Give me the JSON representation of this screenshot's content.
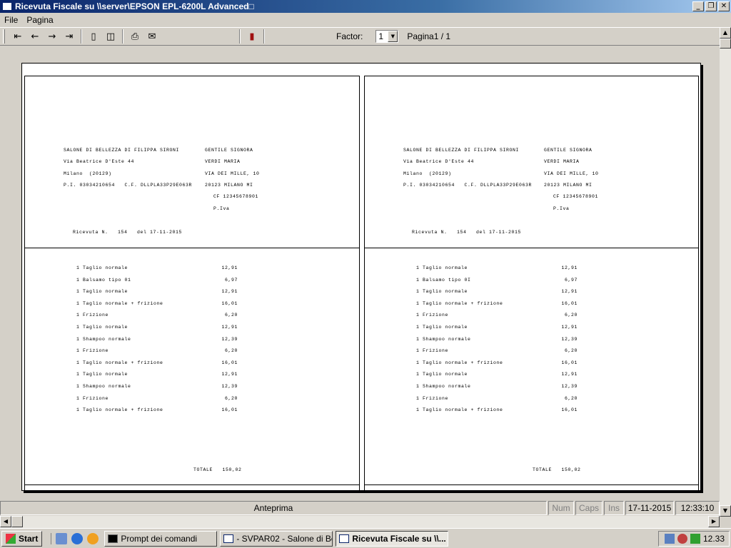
{
  "window": {
    "title": "Ricevuta Fiscale su \\\\server\\EPSON EPL-6200L Advanced□"
  },
  "menu": [
    "File",
    "Pagina"
  ],
  "toolbar": {
    "factor_label": "Factor:",
    "factor_value": "1",
    "page_label": "Pagina1 / 1"
  },
  "receipt": {
    "shop_name": "SALONE DI BELLEZZA DI FILIPPA SIRONI",
    "shop_address": "Via Beatrice D'Este 44",
    "shop_city": "Milano  (20129)",
    "shop_ids": "P.I. 03034210654   C.F. DLLPLA33P29E063R",
    "customer_greeting": "GENTILE SIGNORA",
    "customer_name": "VERDI MARIA",
    "customer_address": "VIA DEI MILLE, 10",
    "customer_city": "20123 MILANO MI",
    "customer_cf": "CF 12345678901",
    "customer_piva": "P.Iva",
    "receipt_number_line": "Ricevuta N.   154   del 17-11-2015",
    "total_line": "TOTALE   150,02"
  },
  "items_left": [
    {
      "desc": "1 Taglio normale",
      "price": "12,91"
    },
    {
      "desc": "1 Balsamo tipo 01",
      "price": "6,97"
    },
    {
      "desc": "1 Taglio normale",
      "price": "12,91"
    },
    {
      "desc": "1 Taglio normale + frizione",
      "price": "16,01"
    },
    {
      "desc": "1 Frizione",
      "price": "6,20"
    },
    {
      "desc": "1 Taglio normale",
      "price": "12,91"
    },
    {
      "desc": "1 Shampoo normale",
      "price": "12,39"
    },
    {
      "desc": "1 Frizione",
      "price": "6,20"
    },
    {
      "desc": "1 Taglio normale + frizione",
      "price": "16,01"
    },
    {
      "desc": "1 Taglio normale",
      "price": "12,91"
    },
    {
      "desc": "1 Shampoo normale",
      "price": "12,39"
    },
    {
      "desc": "1 Frizione",
      "price": "6,20"
    },
    {
      "desc": "1 Taglio normale + frizione",
      "price": "16,01"
    }
  ],
  "items_right": [
    {
      "desc": "1 Taglio normale",
      "price": "12,91"
    },
    {
      "desc": "1 Balsamo tipo 0I",
      "price": "6,97"
    },
    {
      "desc": "1 Taglio normale",
      "price": "12,91"
    },
    {
      "desc": "1 Taglio normale + frizione",
      "price": "16,01"
    },
    {
      "desc": "1 Frizione",
      "price": "6,20"
    },
    {
      "desc": "1 Taglio normale",
      "price": "12,91"
    },
    {
      "desc": "1 Shampoo normale",
      "price": "12,39"
    },
    {
      "desc": "1 Frizione",
      "price": "6,20"
    },
    {
      "desc": "1 Taglio normale + frizione",
      "price": "16,01"
    },
    {
      "desc": "1 Taglio normale",
      "price": "12,91"
    },
    {
      "desc": "1 Shampoo normale",
      "price": "12,39"
    },
    {
      "desc": "1 Frizione",
      "price": "6,20"
    },
    {
      "desc": "1 Taglio normale + frizione",
      "price": "16,01"
    }
  ],
  "statusbar": {
    "mode": "Anteprima",
    "num": "Num",
    "caps": "Caps",
    "ins": "Ins",
    "date": "17-11-2015",
    "time": "12:33:10"
  },
  "taskbar": {
    "start": "Start",
    "tasks": [
      {
        "label": "Prompt dei comandi",
        "icon": "cmd-icon"
      },
      {
        "label": "- SVPAR02 - Salone di Be...",
        "icon": "window-icon"
      },
      {
        "label": "Ricevuta Fiscale su \\\\...",
        "icon": "window-icon"
      }
    ],
    "clock": "12.33"
  }
}
